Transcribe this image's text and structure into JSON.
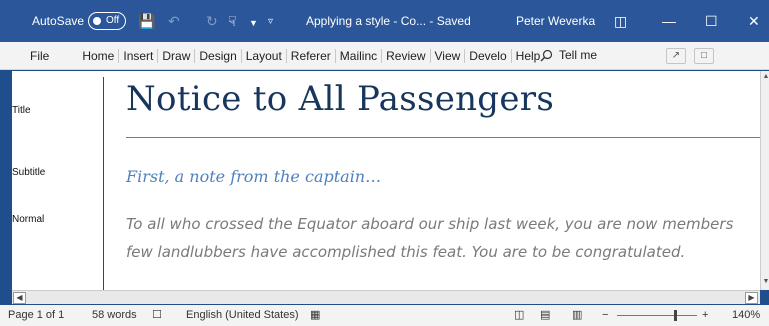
{
  "titlebar": {
    "autosave_label": "AutoSave",
    "autosave_state": "Off",
    "doc_title": "Applying a style - Co... - Saved",
    "user": "Peter Weverka",
    "icons": [
      "save-icon",
      "undo-icon",
      "redo-icon",
      "touch-mode-icon",
      "customize-icon",
      "ribbon-display-icon",
      "minimize-icon",
      "maximize-icon",
      "close-icon"
    ]
  },
  "ribbon": {
    "tabs": [
      "File",
      "Home",
      "Insert",
      "Draw",
      "Design",
      "Layout",
      "Referer",
      "Mailinc",
      "Review",
      "View",
      "Develo",
      "Help"
    ],
    "tell_me": "Tell me"
  },
  "style_pane": {
    "styles": [
      "Title",
      "Subtitle",
      "Normal"
    ]
  },
  "document": {
    "heading": "Notice to All Passengers",
    "subtitle": "First, a note from the captain…",
    "body_lines": [
      "To all who crossed the Equator aboard our ship last week, you are now members",
      "few landlubbers have accomplished this feat. You are to be congratulated."
    ]
  },
  "statusbar": {
    "page": "Page 1 of 1",
    "words": "58 words",
    "language": "English (United States)",
    "zoom": "140%",
    "zoom_fraction": 0.72
  },
  "colors": {
    "titlebar": "#2b579a",
    "heading": "#17365d",
    "accent": "#4f81bd",
    "body_text": "#7a7a7a"
  }
}
